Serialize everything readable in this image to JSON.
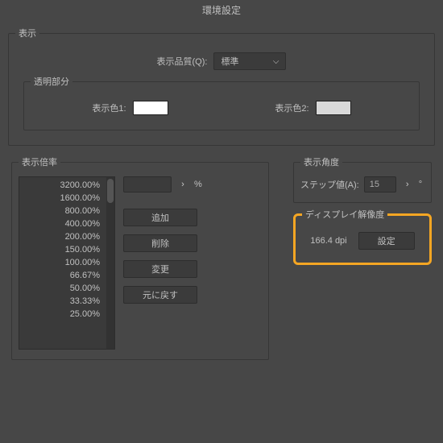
{
  "title": "環境設定",
  "display": {
    "legend": "表示",
    "quality_label": "表示品質(Q):",
    "quality_value": "標準",
    "transparency": {
      "legend": "透明部分",
      "color1_label": "表示色1:",
      "color2_label": "表示色2:"
    }
  },
  "zoom": {
    "legend": "表示倍率",
    "items": [
      "3200.00%",
      "1600.00%",
      "800.00%",
      "400.00%",
      "200.00%",
      "150.00%",
      "100.00%",
      "66.67%",
      "50.00%",
      "33.33%",
      "25.00%"
    ],
    "pct": "%",
    "add": "追加",
    "delete": "削除",
    "change": "変更",
    "reset": "元に戻す"
  },
  "angle": {
    "legend": "表示角度",
    "step_label": "ステップ値(A):",
    "step_value": "15",
    "deg": "°"
  },
  "resolution": {
    "legend": "ディスプレイ解像度",
    "dpi": "166.4 dpi",
    "set": "設定"
  }
}
